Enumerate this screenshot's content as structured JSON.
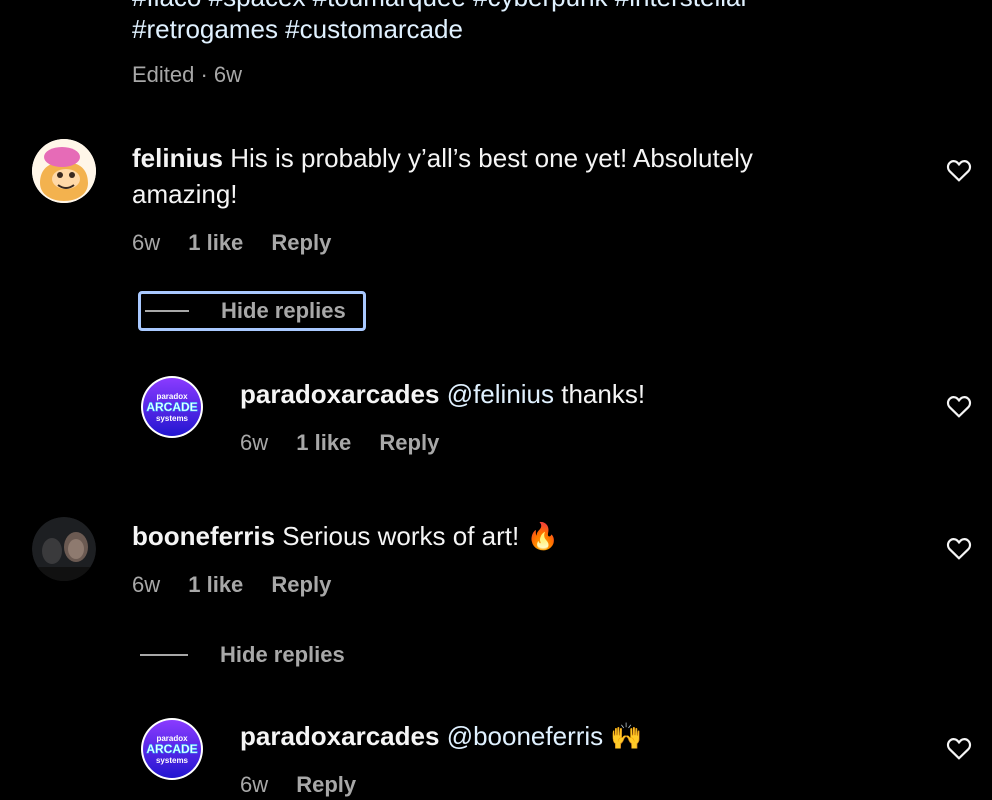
{
  "caption": {
    "line1_partial": "#flaco #spacex #toumarquee #cyberpunk #interstellar",
    "line2": "#retrogames #customarcade",
    "edited": "Edited · 6w"
  },
  "comments": [
    {
      "username": "felinius",
      "text": "His is probably y’all’s best one yet! Absolutely",
      "text2": "amazing!",
      "time": "6w",
      "likes": "1 like",
      "reply": "Reply",
      "hide_replies": "Hide replies",
      "reply_item": {
        "username": "paradoxarcades",
        "mention": "@felinius",
        "text": "thanks!",
        "time": "6w",
        "likes": "1 like",
        "reply": "Reply"
      }
    },
    {
      "username": "booneferris",
      "text": "Serious works of art!",
      "emoji": "🔥",
      "time": "6w",
      "likes": "1 like",
      "reply": "Reply",
      "hide_replies": "Hide replies",
      "reply_item": {
        "username": "paradoxarcades",
        "mention": "@booneferris",
        "emoji": "🙌",
        "time": "6w",
        "reply": "Reply"
      }
    }
  ],
  "avatar_logo": {
    "line1": "paradox",
    "line2": "ARCADE",
    "line3": "systems"
  },
  "colors": {
    "background": "#000000",
    "text": "#f5f5f5",
    "muted": "#a8a8a8",
    "focus": "#a9c9ff",
    "logo_gradient_start": "#7a2cff",
    "logo_gradient_end": "#2a1bd6"
  }
}
